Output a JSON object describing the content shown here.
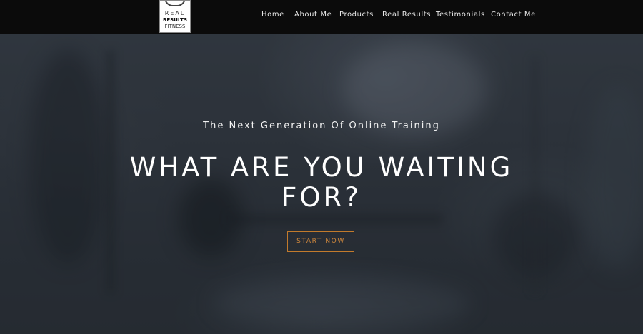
{
  "header": {
    "logo": {
      "line1": "REAL",
      "line2": "RESULTS",
      "line3": "FITNESS"
    },
    "nav": [
      {
        "label": "Home"
      },
      {
        "label": "About Me"
      },
      {
        "label": "Products"
      },
      {
        "label": "Real Results"
      },
      {
        "label": "Testimonials"
      },
      {
        "label": "Contact Me"
      }
    ]
  },
  "hero": {
    "subtitle": "The Next Generation Of Online Training",
    "headline_line1": "WHAT ARE YOU WAITING",
    "headline_line2": "FOR?",
    "cta_label": "START NOW"
  },
  "colors": {
    "header_bg": "#0b0b0b",
    "accent": "#d38a3c",
    "text": "#ffffff"
  }
}
